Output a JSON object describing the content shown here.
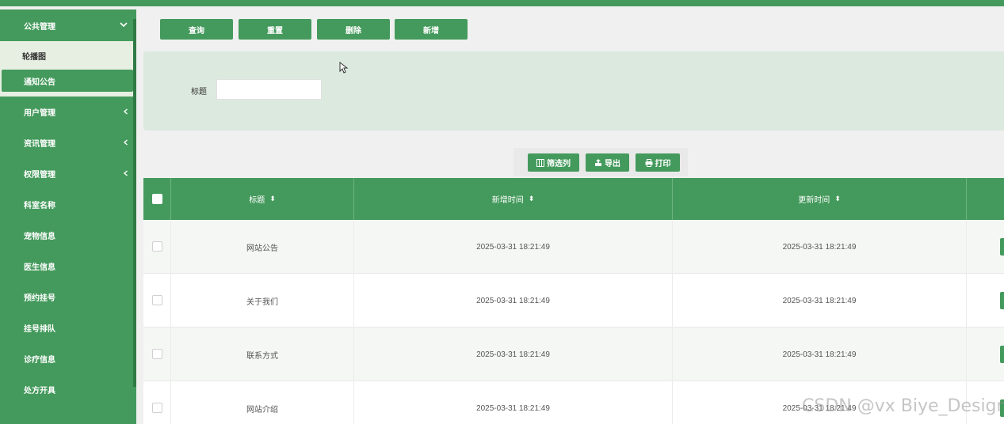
{
  "sidebar": {
    "open_group": "公共管理",
    "submenu": [
      "轮播图",
      "通知公告"
    ],
    "active_submenu": "通知公告",
    "items": [
      {
        "label": "用户管理",
        "has_children": true
      },
      {
        "label": "资讯管理",
        "has_children": true
      },
      {
        "label": "权限管理",
        "has_children": true
      },
      {
        "label": "科室名称",
        "has_children": false
      },
      {
        "label": "宠物信息",
        "has_children": false
      },
      {
        "label": "医生信息",
        "has_children": false
      },
      {
        "label": "预约挂号",
        "has_children": false
      },
      {
        "label": "挂号排队",
        "has_children": false
      },
      {
        "label": "诊疗信息",
        "has_children": false
      },
      {
        "label": "处方开具",
        "has_children": false
      }
    ]
  },
  "toolbar": {
    "query_label": "查询",
    "reset_label": "重置",
    "delete_label": "删除",
    "add_label": "新增"
  },
  "search": {
    "title_label": "标题",
    "title_value": ""
  },
  "table_tools": {
    "filter_label": "筛选列",
    "export_label": "导出",
    "print_label": "打印"
  },
  "table": {
    "columns": [
      "标题",
      "新增时间",
      "更新时间"
    ],
    "rows": [
      {
        "title": "网站公告",
        "created": "2025-03-31 18:21:49",
        "updated": "2025-03-31 18:21:49"
      },
      {
        "title": "关于我们",
        "created": "2025-03-31 18:21:49",
        "updated": "2025-03-31 18:21:49"
      },
      {
        "title": "联系方式",
        "created": "2025-03-31 18:21:49",
        "updated": "2025-03-31 18:21:49"
      },
      {
        "title": "网站介绍",
        "created": "2025-03-31 18:21:49",
        "updated": "2025-03-31 18:21:49"
      }
    ]
  },
  "colors": {
    "accent": "#449a5c",
    "panel": "#dce9df",
    "submenu_bg": "#e6efe1"
  },
  "watermark": "CSDN @vx Biye_Design"
}
